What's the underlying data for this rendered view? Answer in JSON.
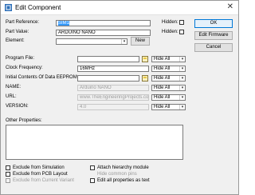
{
  "window": {
    "title": "Edit Component"
  },
  "fields": {
    "part_reference": {
      "label": "Part Reference:",
      "value": "SIM1"
    },
    "part_value": {
      "label": "Part Value:",
      "value": "ARDUINO NANO"
    },
    "element": {
      "label": "Element:",
      "value": ""
    },
    "program_file": {
      "label": "Program File:",
      "value": "",
      "visibility": "Hide All"
    },
    "clock_frequency": {
      "label": "Clock Frequency:",
      "value": "16MHz",
      "visibility": "Hide All"
    },
    "initial_eeprom": {
      "label": "Initial Contents Of Data EEPROM:",
      "value": "",
      "visibility": "Hide All"
    },
    "name": {
      "label": "NAME:",
      "value": "Arduino NANO",
      "visibility": "Hide All"
    },
    "url": {
      "label": "URL:",
      "value": "www.TheEngineeringProjects.com",
      "visibility": "Hide All"
    },
    "version": {
      "label": "VERSION:",
      "value": "4.0",
      "visibility": "Hide All"
    },
    "other_properties": {
      "label": "Other Properties:"
    }
  },
  "hidden_label": "Hidden:",
  "buttons": {
    "new": "New",
    "ok": "OK",
    "edit_firmware": "Edit Firmware",
    "cancel": "Cancel"
  },
  "options": {
    "exclude_simulation": "Exclude from Simulation",
    "exclude_pcb": "Exclude from PCB Layout",
    "exclude_variant": "Exclude from Current Variant",
    "attach_hierarchy": "Attach hierarchy module",
    "hide_pins": "Hide common pins",
    "edit_all_text": "Edit all properties as text"
  },
  "colors": {
    "accent": "#0078d7",
    "selection": "#3399ff"
  }
}
